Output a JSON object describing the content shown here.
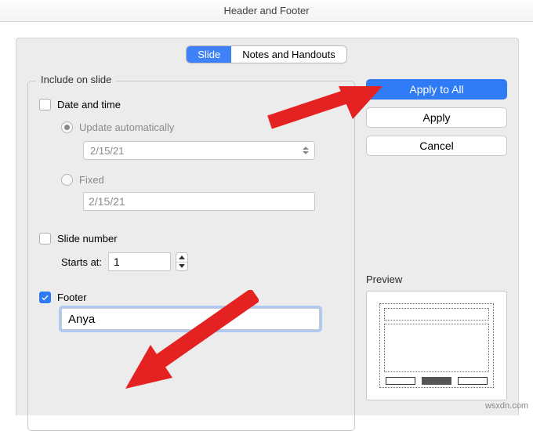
{
  "title": "Header and Footer",
  "tabs": {
    "slide": "Slide",
    "notes": "Notes and Handouts"
  },
  "group": {
    "label": "Include on slide",
    "datetime": {
      "label": "Date and time",
      "checked": false,
      "auto_label": "Update automatically",
      "auto_value": "2/15/21",
      "fixed_label": "Fixed",
      "fixed_value": "2/15/21"
    },
    "slidenum": {
      "label": "Slide number",
      "checked": false,
      "startsat_label": "Starts at:",
      "startsat_value": "1"
    },
    "footer": {
      "label": "Footer",
      "checked": true,
      "value": "Anya"
    }
  },
  "buttons": {
    "apply_all": "Apply to All",
    "apply": "Apply",
    "cancel": "Cancel"
  },
  "preview_label": "Preview",
  "watermark": "wsxdn.com"
}
